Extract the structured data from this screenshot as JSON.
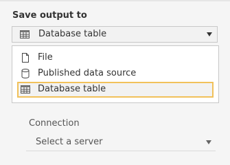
{
  "output": {
    "title": "Save output to",
    "selected_label": "Database table",
    "selected_icon": "database-table-icon",
    "options": [
      {
        "label": "File",
        "icon": "file-icon"
      },
      {
        "label": "Published data source",
        "icon": "database-cylinder-icon"
      },
      {
        "label": "Database table",
        "icon": "database-table-icon"
      }
    ],
    "highlighted_option": "Database table"
  },
  "connection": {
    "label": "Connection",
    "placeholder": "Select a server"
  },
  "colors": {
    "background": "#f5f5f5",
    "menu_background": "#ffffff",
    "highlight_border": "#f1c15a",
    "text": "#333333"
  }
}
